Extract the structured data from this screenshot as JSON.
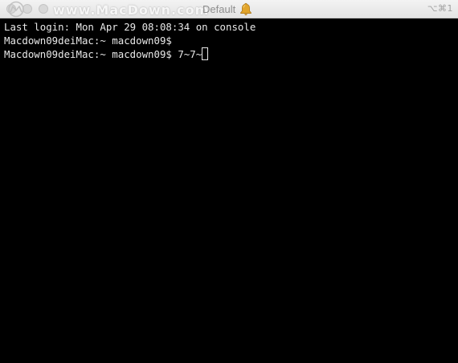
{
  "window": {
    "title": "Default",
    "shortcut": "⌥⌘1",
    "watermark": "www.MacDown.com"
  },
  "icons": {
    "bell": "bell-icon",
    "logo": "macdown-logo-icon"
  },
  "colors": {
    "terminal_background": "#000000",
    "terminal_text": "#e8e8e8",
    "titlebar": "#e8e8e8",
    "bell": "#e2a52b"
  },
  "terminal": {
    "lines": [
      "Last login: Mon Apr 29 08:08:34 on console",
      "Macdown09deiMac:~ macdown09$ ",
      "Macdown09deiMac:~ macdown09$ 7~7~"
    ]
  }
}
